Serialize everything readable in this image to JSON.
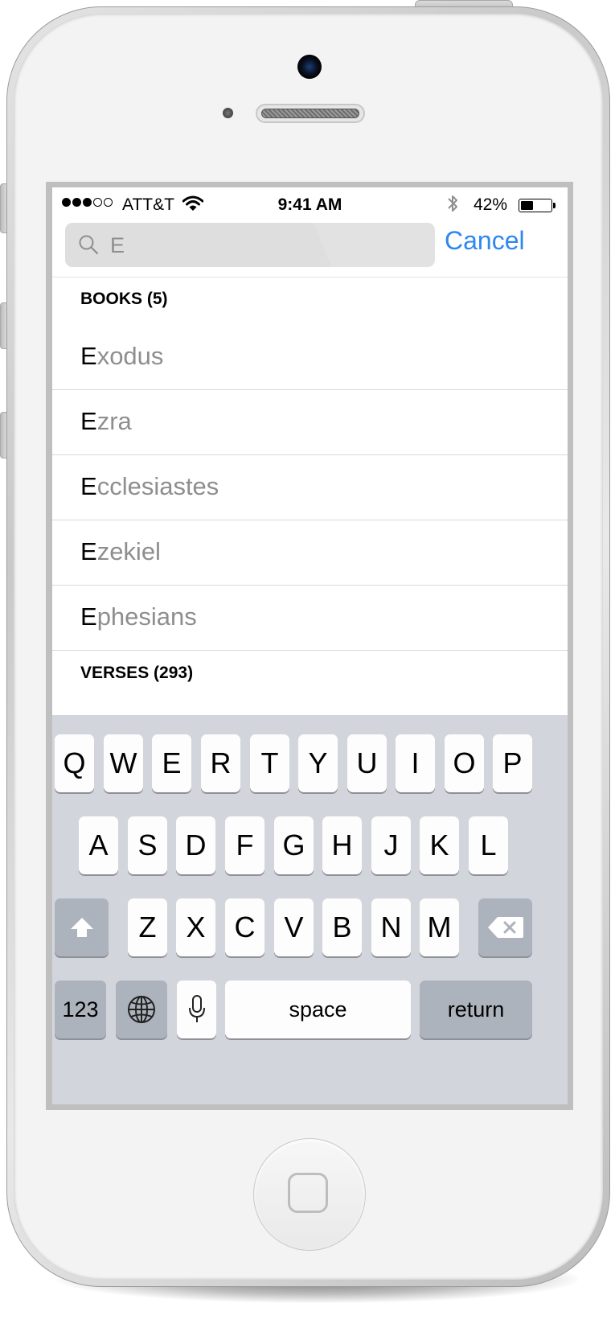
{
  "status_bar": {
    "carrier": "ATT&T",
    "time": "9:41 AM",
    "battery_percent": "42%",
    "battery_level": 0.42,
    "signal_bars_filled": 3,
    "signal_bars_total": 5
  },
  "search": {
    "query": "E",
    "cancel_label": "Cancel"
  },
  "results": {
    "books_header": "BOOKS (5)",
    "books": [
      {
        "match": "E",
        "rest": "xodus"
      },
      {
        "match": "E",
        "rest": "zra"
      },
      {
        "match": "E",
        "rest": "cclesiastes"
      },
      {
        "match": "E",
        "rest": "zekiel"
      },
      {
        "match": "E",
        "rest": "phesians"
      }
    ],
    "verses_header": "VERSES (293)"
  },
  "keyboard": {
    "row1": [
      "Q",
      "W",
      "E",
      "R",
      "T",
      "Y",
      "U",
      "I",
      "O",
      "P"
    ],
    "row2": [
      "A",
      "S",
      "D",
      "F",
      "G",
      "H",
      "J",
      "K",
      "L"
    ],
    "row3": [
      "Z",
      "X",
      "C",
      "V",
      "B",
      "N",
      "M"
    ],
    "numbers_label": "123",
    "space_label": "space",
    "return_label": "return"
  },
  "colors": {
    "accent": "#2f87f0",
    "keyboard_bg": "#d2d5db",
    "function_key": "#adb3bc",
    "dimmed_text": "#8e8e8e"
  }
}
